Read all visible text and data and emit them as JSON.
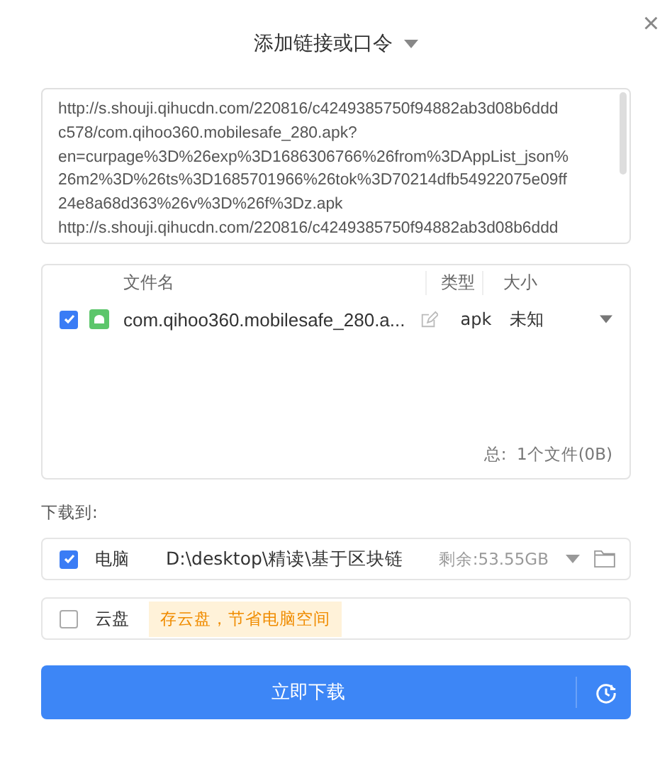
{
  "dialog": {
    "title": "添加链接或口令",
    "close": "×"
  },
  "links": {
    "lines": [
      "http://s.shouji.qihucdn.com/220816/c4249385750f94882ab3d08b6ddd",
      "c578/com.qihoo360.mobilesafe_280.apk?",
      "en=curpage%3D%26exp%3D1686306766%26from%3DAppList_json%",
      "26m2%3D%26ts%3D1685701966%26tok%3D70214dfb54922075e09ff",
      "24e8a68d363%26v%3D%26f%3Dz.apk",
      "http://s.shouji.qihucdn.com/220816/c4249385750f94882ab3d08b6ddd"
    ]
  },
  "files": {
    "columns": [
      "文件名",
      "类型",
      "大小"
    ],
    "rows": [
      {
        "checked": true,
        "name": "com.qihoo360.mobilesafe_280.a...",
        "type": "apk",
        "size": "未知"
      }
    ],
    "total": "总:  1个文件(0B)"
  },
  "save_to": {
    "label": "下载到:",
    "targets": [
      {
        "kind": "local",
        "checked": true,
        "label": "电脑",
        "path": "D:\\desktop\\精读\\基于区块链",
        "free": "剩余:53.55GB"
      },
      {
        "kind": "cloud",
        "checked": false,
        "label": "云盘",
        "hint": "存云盘，节省电脑空间"
      }
    ]
  },
  "download_button": "立即下载"
}
